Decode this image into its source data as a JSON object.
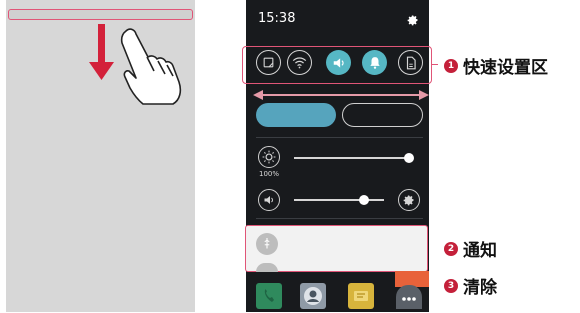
{
  "phone": {
    "time": "15:38",
    "brightness_percent_label": "100%",
    "brightness_level": 1.0,
    "volume_level": 0.78
  },
  "quick_settings": [
    {
      "name": "capture",
      "active": false
    },
    {
      "name": "wifi",
      "active": false
    },
    {
      "name": "sound",
      "active": true
    },
    {
      "name": "notifications",
      "active": true
    },
    {
      "name": "data",
      "active": false
    }
  ],
  "callouts": {
    "one": {
      "number": "1",
      "label": "快速设置区"
    },
    "two": {
      "number": "2",
      "label": "通知"
    },
    "three": {
      "number": "3",
      "label": "清除"
    }
  },
  "colors": {
    "highlight": "#e05577",
    "accent": "#56b7c4",
    "clear": "#e8623a"
  },
  "dock_apps": [
    "phone-icon",
    "contacts-icon",
    "messages-icon",
    "apps-icon"
  ]
}
